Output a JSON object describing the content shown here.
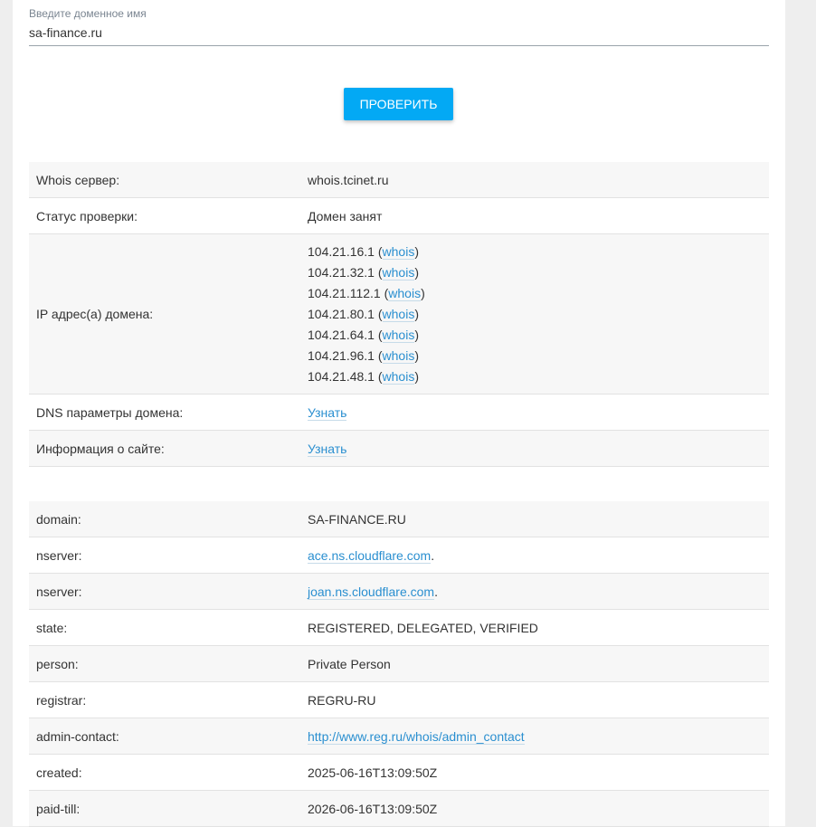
{
  "search": {
    "label": "Введите доменное имя",
    "value": "sa-finance.ru",
    "button": "ПРОВЕРИТЬ"
  },
  "summary": {
    "whois_server": {
      "key": "Whois сервер:",
      "value": "whois.tcinet.ru"
    },
    "status": {
      "key": "Статус проверки:",
      "value": "Домен занят"
    },
    "ips": {
      "key": "IP адрес(а) домена:",
      "link_label": "whois",
      "list": [
        "104.21.16.1",
        "104.21.32.1",
        "104.21.112.1",
        "104.21.80.1",
        "104.21.64.1",
        "104.21.96.1",
        "104.21.48.1"
      ]
    },
    "dns": {
      "key": "DNS параметры домена:",
      "link": "Узнать"
    },
    "site": {
      "key": "Информация о сайте:",
      "link": "Узнать"
    }
  },
  "whois": {
    "domain": {
      "key": "domain:",
      "value": "SA-FINANCE.RU"
    },
    "nserver1": {
      "key": "nserver:",
      "value": "ace.ns.cloudflare.com"
    },
    "nserver2": {
      "key": "nserver:",
      "value": "joan.ns.cloudflare.com"
    },
    "state": {
      "key": "state:",
      "value": "REGISTERED, DELEGATED, VERIFIED"
    },
    "person": {
      "key": "person:",
      "value": "Private Person"
    },
    "registrar": {
      "key": "registrar:",
      "value": "REGRU-RU"
    },
    "admin_contact": {
      "key": "admin-contact:",
      "value": "http://www.reg.ru/whois/admin_contact"
    },
    "created": {
      "key": "created:",
      "value": "2025-06-16T13:09:50Z"
    },
    "paid_till": {
      "key": "paid-till:",
      "value": "2026-06-16T13:09:50Z"
    }
  },
  "colors": {
    "accent": "#03a9f4",
    "link": "#2a8fd0",
    "row_alt": "#f7f7f7"
  }
}
